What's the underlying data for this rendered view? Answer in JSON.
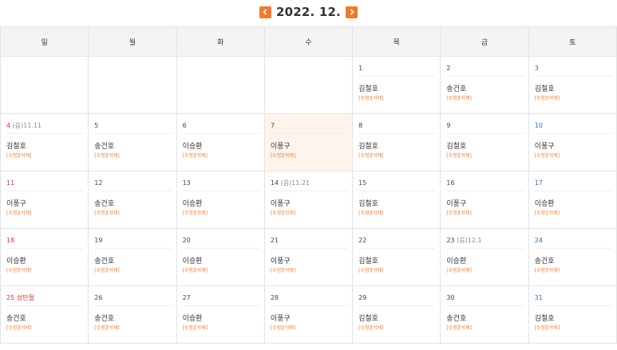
{
  "header": {
    "title": "2022. 12."
  },
  "weekdays": [
    "일",
    "월",
    "화",
    "수",
    "목",
    "금",
    "토"
  ],
  "actions_label": "[수정][삭제]",
  "colors": {
    "accent": "#f07a2a",
    "sunday": "#d9342b",
    "saturday": "#2b6dc9",
    "today_bg": "#fff4ec"
  },
  "weeks": [
    [
      {
        "empty": true
      },
      {
        "empty": true
      },
      {
        "empty": true
      },
      {
        "empty": true
      },
      {
        "day": "1",
        "name": "김철호"
      },
      {
        "day": "2",
        "name": "송건호"
      },
      {
        "day": "3",
        "name": "김철호"
      }
    ],
    [
      {
        "day": "4",
        "lunar": "(음)11.11",
        "name": "김철호"
      },
      {
        "day": "5",
        "name": "송건호"
      },
      {
        "day": "6",
        "name": "이승환"
      },
      {
        "day": "7",
        "name": "이풍구",
        "today": true
      },
      {
        "day": "8",
        "name": "김철호"
      },
      {
        "day": "9",
        "name": "김철호"
      },
      {
        "day": "10",
        "name": "이풍구"
      }
    ],
    [
      {
        "day": "11",
        "name": "이풍구"
      },
      {
        "day": "12",
        "name": "송건호"
      },
      {
        "day": "13",
        "name": "이승환"
      },
      {
        "day": "14",
        "lunar": "(음)11.21",
        "name": "이풍구"
      },
      {
        "day": "15",
        "name": "김철호"
      },
      {
        "day": "16",
        "name": "이풍구"
      },
      {
        "day": "17",
        "name": "이승환"
      }
    ],
    [
      {
        "day": "18",
        "name": "이승환"
      },
      {
        "day": "19",
        "name": "송건호"
      },
      {
        "day": "20",
        "name": "이승환"
      },
      {
        "day": "21",
        "name": "이풍구"
      },
      {
        "day": "22",
        "name": "김철호"
      },
      {
        "day": "23",
        "lunar": "(음)12.1",
        "name": "이승환"
      },
      {
        "day": "24",
        "name": "송건호"
      }
    ],
    [
      {
        "day": "25",
        "holiday": "성탄절",
        "name": "송건호"
      },
      {
        "day": "26",
        "name": "송건호"
      },
      {
        "day": "27",
        "name": "이승환"
      },
      {
        "day": "28",
        "name": "이풍구"
      },
      {
        "day": "29",
        "name": "김철호"
      },
      {
        "day": "30",
        "name": "송건호"
      },
      {
        "day": "31",
        "name": "김철호"
      }
    ]
  ]
}
